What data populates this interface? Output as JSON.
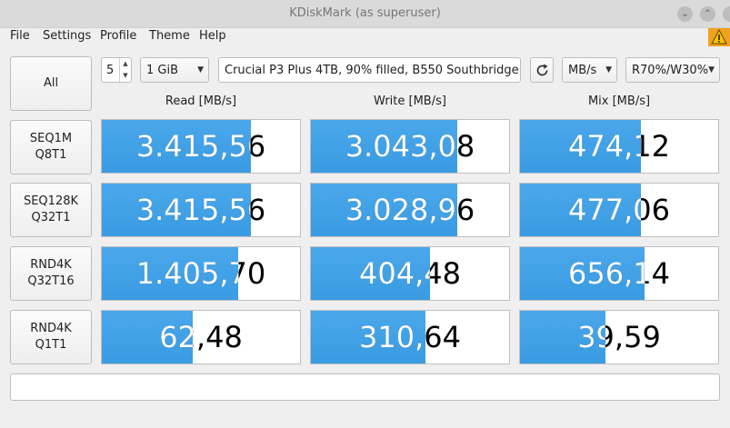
{
  "window": {
    "title": "KDiskMark (as superuser)"
  },
  "menu": [
    "File",
    "Settings",
    "Profile",
    "Theme",
    "Help"
  ],
  "toolbar": {
    "all_label": "All",
    "runs": "5",
    "size": "1 GiB",
    "device": "Crucial P3 Plus 4TB, 90% filled, B550 Southbridge",
    "units": "MB/s",
    "mix": "R70%/W30%"
  },
  "headers": {
    "read": "Read [MB/s]",
    "write": "Write [MB/s]",
    "mix": "Mix [MB/s]"
  },
  "tests": [
    {
      "line1": "SEQ1M",
      "line2": "Q8T1",
      "read": {
        "value": "3.415,56",
        "fill": 0.75
      },
      "write": {
        "value": "3.043,08",
        "fill": 0.74
      },
      "mix": {
        "value": "474,12",
        "fill": 0.61
      }
    },
    {
      "line1": "SEQ128K",
      "line2": "Q32T1",
      "read": {
        "value": "3.415,56",
        "fill": 0.75
      },
      "write": {
        "value": "3.028,96",
        "fill": 0.74
      },
      "mix": {
        "value": "477,06",
        "fill": 0.61
      }
    },
    {
      "line1": "RND4K",
      "line2": "Q32T16",
      "read": {
        "value": "1.405,70",
        "fill": 0.69
      },
      "write": {
        "value": "404,48",
        "fill": 0.6
      },
      "mix": {
        "value": "656,14",
        "fill": 0.63
      }
    },
    {
      "line1": "RND4K",
      "line2": "Q1T1",
      "read": {
        "value": "62,48",
        "fill": 0.46
      },
      "write": {
        "value": "310,64",
        "fill": 0.58
      },
      "mix": {
        "value": "39,59",
        "fill": 0.43
      }
    }
  ],
  "colors": {
    "bar": "#3a9be2",
    "warning": "#f2a11f"
  },
  "icons": {
    "warning": "warning-icon",
    "refresh": "refresh-icon"
  }
}
